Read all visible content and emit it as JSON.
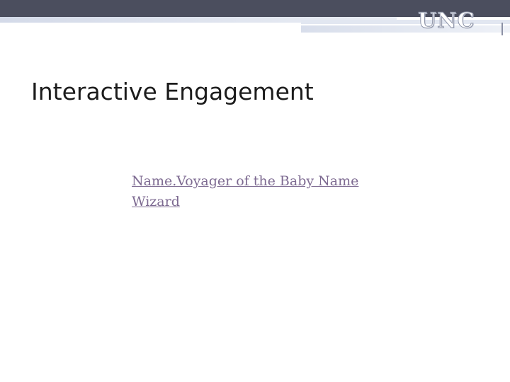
{
  "header": {
    "logo_text": "UNC"
  },
  "slide": {
    "title": "Interactive Engagement",
    "link_text": "Name.Voyager of the Baby Name Wizard"
  },
  "colors": {
    "top_bar": "#4b4e5e",
    "link": "#7d6a91",
    "title": "#1c1c1c"
  }
}
